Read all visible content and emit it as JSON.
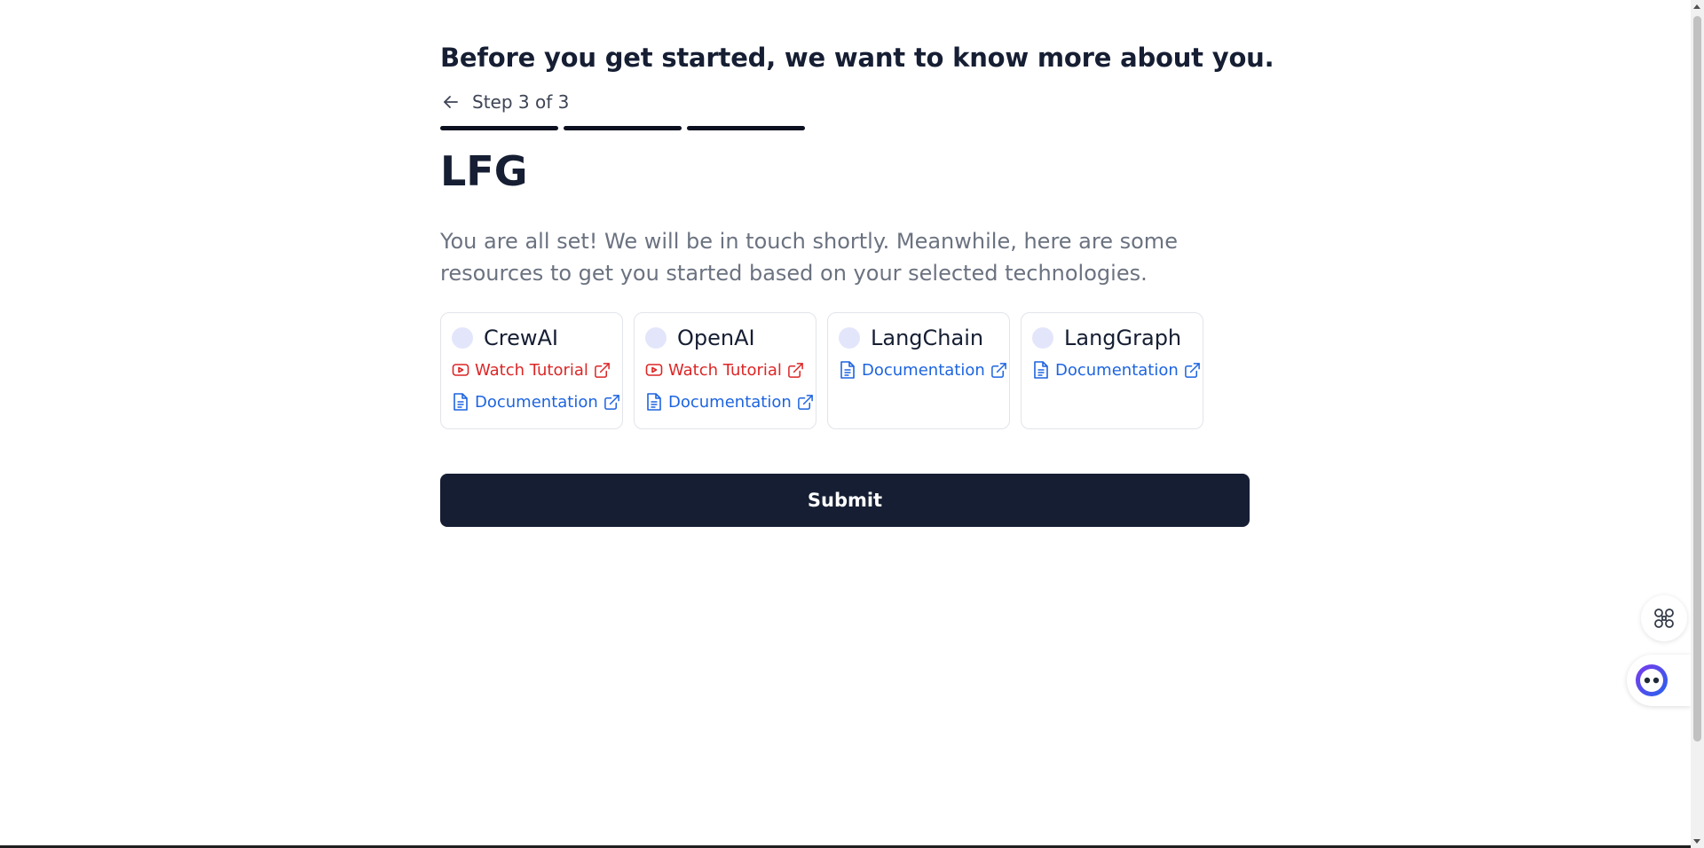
{
  "header": {
    "headline": "Before you get started, we want to know more about you.",
    "step_label": "Step 3 of 3",
    "progress": {
      "current_step": 3,
      "total_steps": 3
    }
  },
  "main": {
    "title": "LFG",
    "description": "You are all set! We will be in touch shortly. Meanwhile, here are some resources to get you started based on your selected technologies.",
    "cards": [
      {
        "name": "CrewAI",
        "tutorial_label": "Watch Tutorial",
        "docs_label": "Documentation"
      },
      {
        "name": "OpenAI",
        "tutorial_label": "Watch Tutorial",
        "docs_label": "Documentation"
      },
      {
        "name": "LangChain",
        "docs_label": "Documentation"
      },
      {
        "name": "LangGraph",
        "docs_label": "Documentation"
      }
    ],
    "submit_label": "Submit"
  },
  "floating": {
    "apps_icon": "apps-command-icon",
    "assistant_icon": "assistant-bot-icon"
  },
  "colors": {
    "primary": "#161e33",
    "tutorial_link": "#dc2626",
    "docs_link": "#1d64e0",
    "muted_text": "#6b7280",
    "card_dot": "#e3e6fb"
  }
}
